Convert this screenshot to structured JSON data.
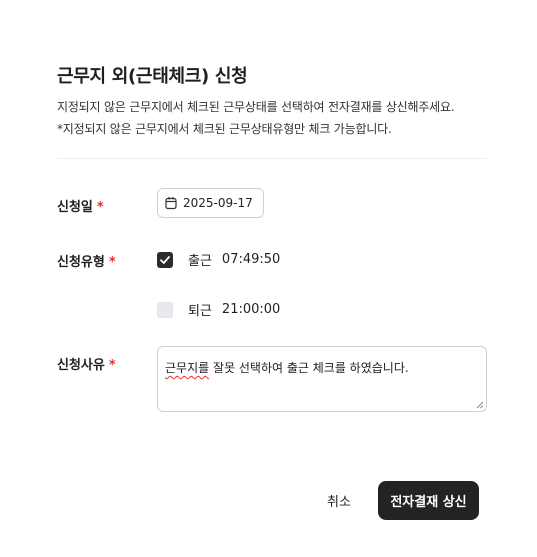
{
  "dialog": {
    "title": "근무지 외(근태체크) 신청",
    "description_line1": "지정되지 않은 근무지에서 체크된 근무상태를 선택하여 전자결재를 상신해주세요.",
    "description_line2": "*지정되지 않은 근무지에서 체크된 근무상태유형만 체크 가능합니다."
  },
  "form": {
    "required_mark": "*",
    "date": {
      "label": "신청일",
      "value": "2025-09-17",
      "icon": "calendar-icon"
    },
    "type": {
      "label": "신청유형",
      "options": [
        {
          "label": "출근",
          "time": "07:49:50",
          "checked": true
        },
        {
          "label": "퇴근",
          "time": "21:00:00",
          "checked": false
        }
      ]
    },
    "reason": {
      "label": "신청사유",
      "value_misspelled": "근무지를",
      "value_rest": " 잘못 선택하여 출근 체크를 하였습니다."
    }
  },
  "actions": {
    "cancel_label": "취소",
    "submit_label": "전자결재 상신"
  },
  "colors": {
    "required": "#e5322d",
    "primary_button": "#232323",
    "checkbox_checked": "#2b2b2b",
    "checkbox_unchecked": "#e7e9ee"
  }
}
